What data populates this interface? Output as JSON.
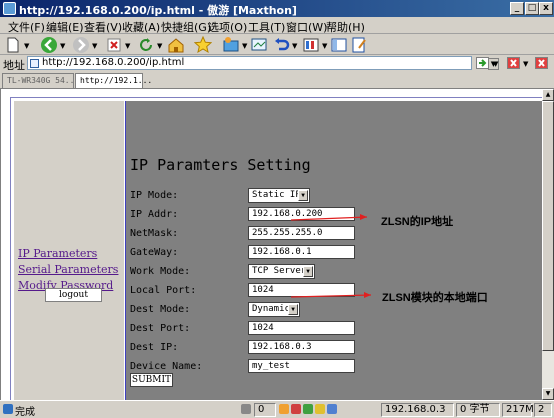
{
  "window": {
    "title": "http://192.168.0.200/ip.html - 傲游 [Maxthon]",
    "min": "_",
    "max": "□",
    "close": "x"
  },
  "menu": [
    "文件(F)",
    "编辑(E)",
    "查看(V)",
    "收藏(A)",
    "快捷组(G)",
    "选项(O)",
    "工具(T)",
    "窗口(W)",
    "帮助(H)"
  ],
  "address": {
    "label": "地址",
    "url": "http://192.168.0.200/ip.html"
  },
  "tabs": [
    "TL-WR340G 54...",
    "http://192.1..."
  ],
  "nav": {
    "links": [
      "IP Parameters",
      "Serial Parameters",
      "Modify Password"
    ],
    "logout": "logout"
  },
  "form": {
    "heading": "IP Paramters Setting",
    "fields": [
      {
        "label": "IP Mode:",
        "value": "Static IP"
      },
      {
        "label": "IP Addr:",
        "value": "192.168.0.200"
      },
      {
        "label": "NetMask:",
        "value": "255.255.255.0"
      },
      {
        "label": "GateWay:",
        "value": "192.168.0.1"
      },
      {
        "label": "Work Mode:",
        "value": "TCP Server"
      },
      {
        "label": "Local Port:",
        "value": "1024"
      },
      {
        "label": "Dest Mode:",
        "value": "Dynamic"
      },
      {
        "label": "Dest Port:",
        "value": "1024"
      },
      {
        "label": "Dest IP:",
        "value": "192.168.0.3"
      },
      {
        "label": "Device Name:",
        "value": "my_test"
      }
    ],
    "submit": "SUBMIT"
  },
  "annotations": {
    "ip": "ZLSN的IP地址",
    "port": "ZLSN模块的本地端口"
  },
  "colors": {
    "arrow": "#e02020",
    "form_bg": "#808080",
    "link": "#551a8b"
  },
  "status": {
    "text": "完成",
    "count": "0",
    "ip": "192.168.0.3",
    "bytes": "0 字节",
    "memory": "217M",
    "tabcount": "2"
  }
}
